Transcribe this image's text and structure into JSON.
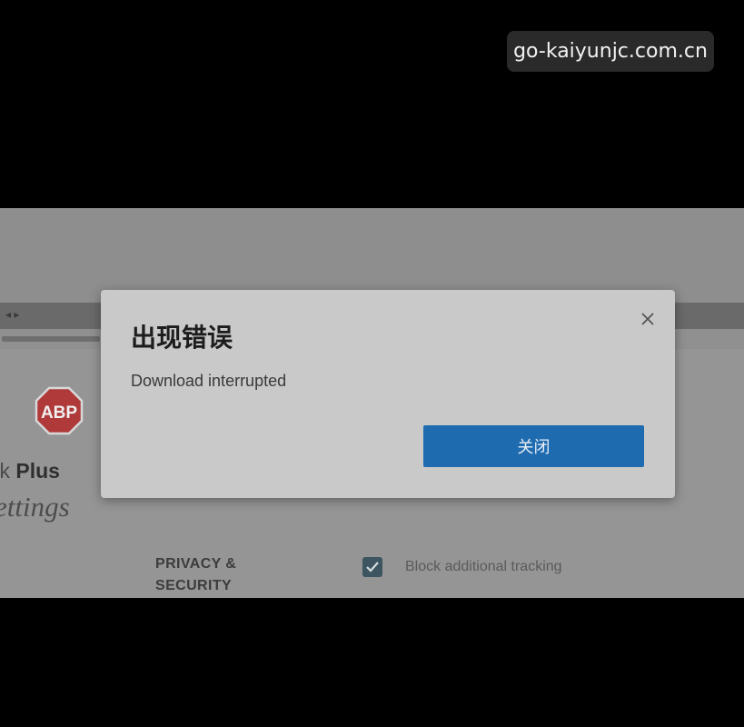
{
  "watermark": {
    "text": "go-kaiyunjc.com.cn"
  },
  "browser": {
    "nav_icons": [
      "back-arrow-icon",
      "forward-arrow-icon"
    ]
  },
  "settings_page": {
    "logo_text": "ABP",
    "brand_partial": "ck ",
    "brand_bold": "Plus",
    "heading_partial": "ettings",
    "section_title_line1": "PRIVACY &",
    "section_title_line2": "SECURITY",
    "checkbox_checked": true,
    "checkbox_label": "Block additional tracking"
  },
  "dialog": {
    "title": "出现错误",
    "message": "Download interrupted",
    "close_icon": "close-icon",
    "button_label": "关闭"
  },
  "colors": {
    "dialog_bg": "#c9c9c9",
    "button": "#1e6bb0",
    "logo_red": "#b03a3a",
    "checkbox": "#3d5560"
  }
}
